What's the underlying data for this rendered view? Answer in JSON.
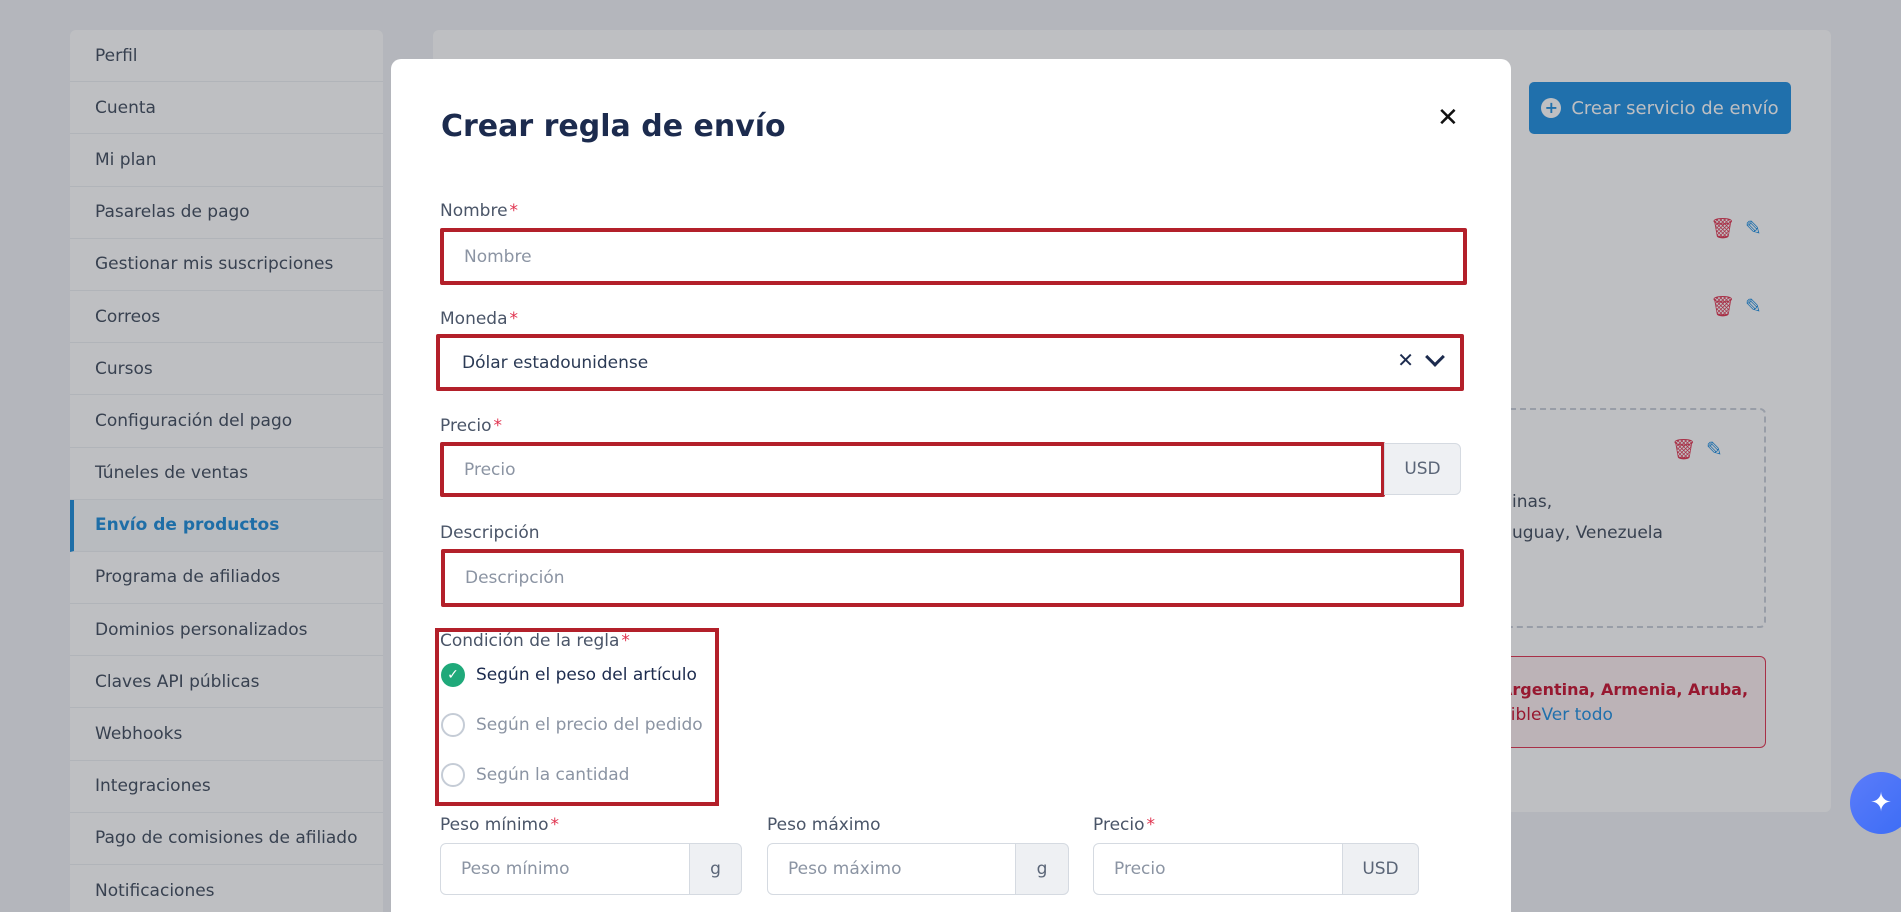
{
  "sidebar": {
    "items": [
      {
        "label": "Perfil"
      },
      {
        "label": "Cuenta"
      },
      {
        "label": "Mi plan"
      },
      {
        "label": "Pasarelas de pago"
      },
      {
        "label": "Gestionar mis suscripciones"
      },
      {
        "label": "Correos"
      },
      {
        "label": "Cursos"
      },
      {
        "label": "Configuración del pago"
      },
      {
        "label": "Túneles de ventas"
      },
      {
        "label": "Envío de productos",
        "active": true
      },
      {
        "label": "Programa de afiliados"
      },
      {
        "label": "Dominios personalizados"
      },
      {
        "label": "Claves API públicas"
      },
      {
        "label": "Webhooks"
      },
      {
        "label": "Integraciones"
      },
      {
        "label": "Pago de comisiones de afiliado"
      },
      {
        "label": "Notificaciones"
      }
    ]
  },
  "background": {
    "create_button_label": "Crear servicio de envío",
    "zone_text_line1": "inas,",
    "zone_text_line2": "uguay, Venezuela",
    "alert_line1": "Argentina, Armenia, Aruba,",
    "alert_line2_red": "nible",
    "alert_line2_link": "Ver todo"
  },
  "modal": {
    "title": "Crear regla de envío",
    "name": {
      "label": "Nombre",
      "placeholder": "Nombre",
      "value": ""
    },
    "currency": {
      "label": "Moneda",
      "value": "Dólar estadounidense"
    },
    "price": {
      "label": "Precio",
      "placeholder": "Precio",
      "addon": "USD"
    },
    "description": {
      "label": "Descripción",
      "placeholder": "Descripción"
    },
    "rule_condition": {
      "label": "Condición de la regla",
      "options": [
        {
          "label": "Según el peso del artículo",
          "selected": true
        },
        {
          "label": "Según el precio del pedido",
          "selected": false
        },
        {
          "label": "Según la cantidad",
          "selected": false
        }
      ]
    },
    "min_weight": {
      "label": "Peso mínimo",
      "placeholder": "Peso mínimo",
      "addon": "g"
    },
    "max_weight": {
      "label": "Peso máximo",
      "placeholder": "Peso máximo",
      "addon": "g"
    },
    "row_price": {
      "label": "Precio",
      "placeholder": "Precio",
      "addon": "USD"
    }
  },
  "colors": {
    "accent": "#1e8ee0",
    "highlight": "#b3202a",
    "success": "#1fa97a",
    "danger": "#e0334f"
  },
  "icons": {
    "close": "close-icon",
    "trash": "trash-icon",
    "edit": "pencil-icon",
    "plus": "plus-circle-icon",
    "ai": "sparkle-icon"
  }
}
